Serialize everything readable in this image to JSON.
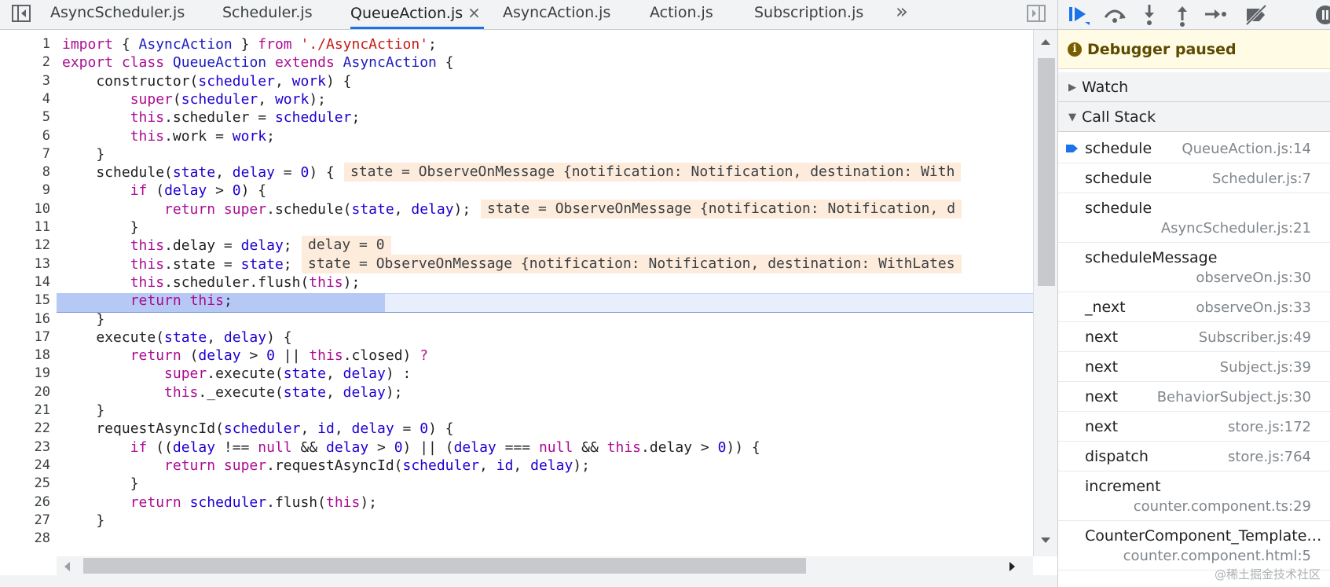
{
  "tabs": [
    {
      "label": "AsyncScheduler.js"
    },
    {
      "label": "Scheduler.js"
    },
    {
      "label": "QueueAction.js",
      "close": "×"
    },
    {
      "label": "AsyncAction.js"
    },
    {
      "label": "Action.js"
    },
    {
      "label": "Subscription.js"
    }
  ],
  "tabs_more": "»",
  "code_lines": [
    {
      "n": "1"
    },
    {
      "n": "2"
    },
    {
      "n": "3"
    },
    {
      "n": "4"
    },
    {
      "n": "5"
    },
    {
      "n": "6"
    },
    {
      "n": "7"
    },
    {
      "n": "8"
    },
    {
      "n": "9"
    },
    {
      "n": "10"
    },
    {
      "n": "11"
    },
    {
      "n": "12"
    },
    {
      "n": "13"
    },
    {
      "n": "14"
    },
    {
      "n": "15"
    },
    {
      "n": "16"
    },
    {
      "n": "17"
    },
    {
      "n": "18"
    },
    {
      "n": "19"
    },
    {
      "n": "20"
    },
    {
      "n": "21"
    },
    {
      "n": "22"
    },
    {
      "n": "23"
    },
    {
      "n": "24"
    },
    {
      "n": "25"
    },
    {
      "n": "26"
    },
    {
      "n": "27"
    },
    {
      "n": "28"
    }
  ],
  "code": {
    "l1": [
      "import",
      " { ",
      "AsyncAction",
      " } ",
      "from",
      " ",
      "'./AsyncAction'",
      ";"
    ],
    "l2": [
      "export",
      " ",
      "class",
      " ",
      "QueueAction",
      " ",
      "extends",
      " ",
      "AsyncAction",
      " {"
    ],
    "l3": [
      "    constructor(",
      "scheduler",
      ", ",
      "work",
      ") {"
    ],
    "l4": [
      "        ",
      "super",
      "(",
      "scheduler",
      ", ",
      "work",
      ");"
    ],
    "l5": [
      "        ",
      "this",
      ".scheduler = ",
      "scheduler",
      ";"
    ],
    "l6": [
      "        ",
      "this",
      ".work = ",
      "work",
      ";"
    ],
    "l7": [
      "    }"
    ],
    "l8": [
      "    schedule(",
      "state",
      ", ",
      "delay",
      " = ",
      "0",
      ") {"
    ],
    "l9": [
      "        ",
      "if",
      " (",
      "delay",
      " > ",
      "0",
      ") {"
    ],
    "l10": [
      "            ",
      "return",
      " ",
      "super",
      ".schedule(",
      "state",
      ", ",
      "delay",
      ");"
    ],
    "l11": [
      "        }"
    ],
    "l12": [
      "        ",
      "this",
      ".delay = ",
      "delay",
      ";"
    ],
    "l13": [
      "        ",
      "this",
      ".state = ",
      "state",
      ";"
    ],
    "l14": [
      "        ",
      "this",
      ".scheduler.flush(",
      "this",
      ");"
    ],
    "l15": [
      "        ",
      "return",
      " ",
      "this",
      ";"
    ],
    "l16": [
      "    }"
    ],
    "l17": [
      "    execute(",
      "state",
      ", ",
      "delay",
      ") {"
    ],
    "l18": [
      "        ",
      "return",
      " (",
      "delay",
      " > ",
      "0",
      " || ",
      "this",
      ".closed) ",
      "?"
    ],
    "l19": [
      "            ",
      "super",
      ".execute(",
      "state",
      ", ",
      "delay",
      ") :"
    ],
    "l20": [
      "            ",
      "this",
      "._execute(",
      "state",
      ", ",
      "delay",
      ");"
    ],
    "l21": [
      "    }"
    ],
    "l22": [
      "    requestAsyncId(",
      "scheduler",
      ", ",
      "id",
      ", ",
      "delay",
      " = ",
      "0",
      ") {"
    ],
    "l23": [
      "        ",
      "if",
      " ((",
      "delay",
      " !== ",
      "null",
      " && ",
      "delay",
      " > ",
      "0",
      ") || (",
      "delay",
      " === ",
      "null",
      " && ",
      "this",
      ".delay > ",
      "0",
      ")) {"
    ],
    "l24": [
      "            ",
      "return",
      " ",
      "super",
      ".requestAsyncId(",
      "scheduler",
      ", ",
      "id",
      ", ",
      "delay",
      ");"
    ],
    "l25": [
      "        }"
    ],
    "l26": [
      "        ",
      "return",
      " ",
      "scheduler",
      ".flush(",
      "this",
      ");"
    ],
    "l27": [
      "    }"
    ]
  },
  "inline_values": {
    "l8": "state = ObserveOnMessage {notification: Notification, destination: With",
    "l10": "state = ObserveOnMessage {notification: Notification, d",
    "l12": "delay = 0",
    "l13": "state = ObserveOnMessage {notification: Notification, destination: WithLates"
  },
  "debugger": {
    "status": "Debugger paused",
    "watch_label": "Watch",
    "callstack_label": "Call Stack",
    "frames": [
      {
        "name": "schedule",
        "loc": "QueueAction.js:14"
      },
      {
        "name": "schedule",
        "loc": "Scheduler.js:7"
      },
      {
        "name": "schedule",
        "loc": "AsyncScheduler.js:21"
      },
      {
        "name": "scheduleMessage",
        "loc": "observeOn.js:30"
      },
      {
        "name": "_next",
        "loc": "observeOn.js:33"
      },
      {
        "name": "next",
        "loc": "Subscriber.js:49"
      },
      {
        "name": "next",
        "loc": "Subject.js:39"
      },
      {
        "name": "next",
        "loc": "BehaviorSubject.js:30"
      },
      {
        "name": "next",
        "loc": "store.js:172"
      },
      {
        "name": "dispatch",
        "loc": "store.js:764"
      },
      {
        "name": "increment",
        "loc": "counter.component.ts:29"
      },
      {
        "name": "CounterComponent_Template…",
        "loc": "counter.component.html:5"
      }
    ]
  },
  "watermark": "@稀土掘金技术社区",
  "colors": {
    "accent": "#1a73e8",
    "paused_bg": "#fffbe5",
    "inline_bg": "#fdebdc",
    "exec_line": "#e8eefc"
  }
}
